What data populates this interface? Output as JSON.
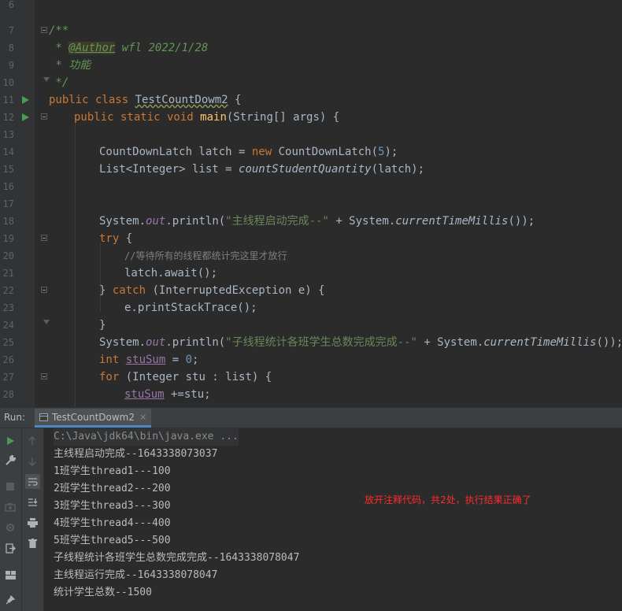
{
  "editor": {
    "lines": [
      {
        "n": "6"
      },
      {
        "n": "7"
      },
      {
        "n": "8"
      },
      {
        "n": "9"
      },
      {
        "n": "10"
      },
      {
        "n": "11"
      },
      {
        "n": "12"
      },
      {
        "n": "13"
      },
      {
        "n": "14"
      },
      {
        "n": "15"
      },
      {
        "n": "16"
      },
      {
        "n": "17"
      },
      {
        "n": "18"
      },
      {
        "n": "19"
      },
      {
        "n": "20"
      },
      {
        "n": "21"
      },
      {
        "n": "22"
      },
      {
        "n": "23"
      },
      {
        "n": "24"
      },
      {
        "n": "25"
      },
      {
        "n": "26"
      },
      {
        "n": "27"
      },
      {
        "n": "28"
      }
    ],
    "tokens": {
      "l7": "/**",
      "l8_a": " * ",
      "l8_tag": "@Author",
      "l8_b": " wfl 2022/1/28",
      "l9": " * 功能",
      "l10": " */",
      "l11_kw": "public class ",
      "l11_name": "TestCountDowm2",
      "l11_end": " {",
      "l12_kw": "public static void ",
      "l12_fn": "main",
      "l12_end": "(String[] args) {",
      "l14_a": "CountDownLatch latch = ",
      "l14_kw": "new ",
      "l14_b": "CountDownLatch(",
      "l14_num": "5",
      "l14_c": ");",
      "l15_a": "List<Integer> list = ",
      "l15_fn": "countStudentQuantity",
      "l15_b": "(latch);",
      "l18_a": "System.",
      "l18_out": "out",
      "l18_b": ".println(",
      "l18_str": "\"主线程启动完成--\"",
      "l18_c": " + System.",
      "l18_m": "currentTimeMillis",
      "l18_d": "());",
      "l19_kw": "try",
      "l19_b": " {",
      "l20": "//等待所有的线程都统计完这里才放行",
      "l21": "latch.await();",
      "l22_a": "} ",
      "l22_kw": "catch",
      "l22_b": " (InterruptedException e) {",
      "l23": "e.printStackTrace();",
      "l24": "}",
      "l25_a": "System.",
      "l25_out": "out",
      "l25_b": ".println(",
      "l25_str": "\"子线程统计各班学生总数完成完成--\"",
      "l25_c": " + System.",
      "l25_m": "currentTimeMillis",
      "l25_d": "());",
      "l26_kw": "int ",
      "l26_var": "stuSum",
      "l26_b": " = ",
      "l26_num": "0",
      "l26_c": ";",
      "l27_kw": "for",
      "l27_b": " (Integer stu : list) {",
      "l28_var": "stuSum",
      "l28_b": " +=stu;"
    }
  },
  "run_panel": {
    "label": "Run:",
    "tab_label": "TestCountDowm2",
    "tab_close": "×",
    "output": [
      "C:\\Java\\jdk64\\bin\\java.exe ...",
      "主线程启动完成--1643338073037",
      "1班学生thread1---100",
      "2班学生thread2---200",
      "3班学生thread3---300",
      "4班学生thread4---400",
      "5班学生thread5---500",
      "子线程统计各班学生总数完成完成--1643338078047",
      "主线程运行完成--1643338078047",
      "统计学生总数--1500"
    ],
    "annotation": "放开注释代码，共2处，执行结果正确了"
  },
  "colors": {
    "background": "#2b2b2b",
    "keyword": "#cc7832",
    "comment": "#629755",
    "string": "#6a8759",
    "number": "#6897bb",
    "annotation": "#ff2a2a"
  }
}
